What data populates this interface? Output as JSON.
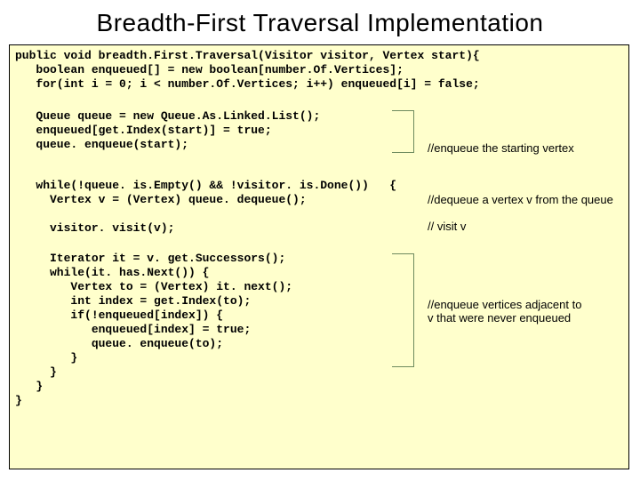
{
  "title": "Breadth-First Traversal Implementation",
  "code": {
    "sig": [
      "public void breadth.First.Traversal(Visitor visitor, Vertex start){",
      "   boolean enqueued[] = new boolean[number.Of.Vertices];",
      "   for(int i = 0; i < number.Of.Vertices; i++) enqueued[i] = false;"
    ],
    "init": [
      "   Queue queue = new Queue.As.Linked.List();",
      "   enqueued[get.Index(start)] = true;",
      "   queue. enqueue(start);"
    ],
    "loop1": [
      "   while(!queue. is.Empty() && !visitor. is.Done())   {",
      "     Vertex v = (Vertex) queue. dequeue();"
    ],
    "visit": [
      "     visitor. visit(v);"
    ],
    "iter": [
      "     Iterator it = v. get.Successors();",
      "     while(it. has.Next()) {",
      "        Vertex to = (Vertex) it. next();",
      "        int index = get.Index(to);",
      "        if(!enqueued[index]) {",
      "           enqueued[index] = true;",
      "           queue. enqueue(to);",
      "        }",
      "     }",
      "   }",
      "}"
    ]
  },
  "annotations": {
    "a1": "//enqueue the starting vertex",
    "a2": "//dequeue a vertex v from the queue",
    "a3": "// visit v",
    "a4_line1": "//enqueue vertices adjacent to",
    "a4_line2": "v that were never enqueued"
  }
}
